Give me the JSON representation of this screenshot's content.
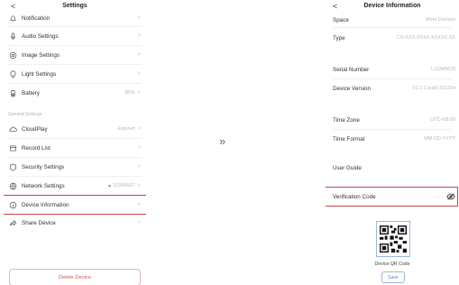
{
  "left": {
    "title": "Settings",
    "back": "<",
    "items_top": [
      {
        "key": "notification",
        "label": "Notification",
        "value": ""
      },
      {
        "key": "audio",
        "label": "Audio Settings",
        "value": ""
      },
      {
        "key": "image",
        "label": "Image Settings",
        "value": ""
      },
      {
        "key": "light",
        "label": "Light Settings",
        "value": ""
      },
      {
        "key": "battery",
        "label": "Battery",
        "value": "80%"
      }
    ],
    "section_label": "General Settings",
    "items_general": [
      {
        "key": "cloudplay",
        "label": "CloudPlay",
        "value": "Expired"
      },
      {
        "key": "record",
        "label": "Record List",
        "value": ""
      },
      {
        "key": "security",
        "label": "Security Settings",
        "value": ""
      },
      {
        "key": "network",
        "label": "Network Settings",
        "value": "12345667"
      },
      {
        "key": "device-info",
        "label": "Device Information",
        "value": ""
      },
      {
        "key": "share",
        "label": "Share Device",
        "value": ""
      }
    ],
    "delete_label": "Delete Device"
  },
  "arrow": "»",
  "right": {
    "title": "Device Information",
    "back": "<",
    "rows": [
      {
        "key": "space",
        "label": "Space",
        "value": "More Devices"
      },
      {
        "key": "type",
        "label": "Type",
        "value": "CS-XXX-XXXX-XXXXX-XX"
      },
      {
        "key": "serial",
        "label": "Serial Number",
        "value": "L12345678"
      },
      {
        "key": "version",
        "label": "Device Version",
        "value": "V1.2.1 build 221214"
      },
      {
        "key": "timezone",
        "label": "Time Zone",
        "value": "UTC+08:00"
      },
      {
        "key": "timeformat",
        "label": "Time Format",
        "value": "MM-DD-YYYY"
      },
      {
        "key": "guide",
        "label": "User Guide",
        "value": ""
      },
      {
        "key": "verification",
        "label": "Verification Code",
        "value": "......"
      }
    ],
    "qr_caption": "Device QR Code",
    "save_label": "Save"
  },
  "colors": {
    "highlight": "#c94545",
    "link": "#5b87c6"
  }
}
